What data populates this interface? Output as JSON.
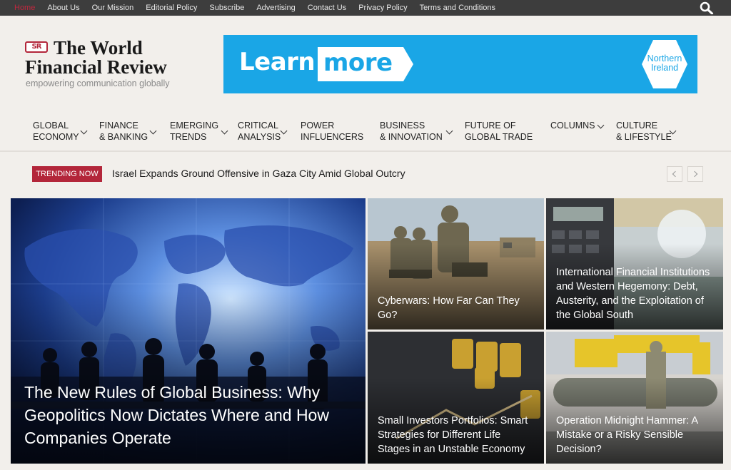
{
  "topnav": {
    "items": [
      "Home",
      "About Us",
      "Our Mission",
      "Editorial Policy",
      "Subscribe",
      "Advertising",
      "Contact Us",
      "Privacy Policy",
      "Terms and Conditions"
    ]
  },
  "logo": {
    "mark": "SR",
    "line1": "The World",
    "line2": "Financial Review",
    "tagline": "empowering communication globally"
  },
  "ad": {
    "learn": "Learn",
    "more": "more",
    "badge_line1": "Northern",
    "badge_line2": "Ireland",
    "colors": {
      "background": "#1aa6e6",
      "text": "#ffffff"
    }
  },
  "mainnav": {
    "items": [
      {
        "line1": "GLOBAL",
        "line2": "ECONOMY"
      },
      {
        "line1": "FINANCE",
        "line2": "& BANKING"
      },
      {
        "line1": "EMERGING",
        "line2": "TRENDS"
      },
      {
        "line1": "CRITICAL",
        "line2": "ANALYSIS"
      },
      {
        "line1": "POWER",
        "line2": "INFLUENCERS"
      },
      {
        "line1": "BUSINESS",
        "line2": "& INNOVATION"
      },
      {
        "line1": "FUTURE OF",
        "line2": "GLOBAL TRADE"
      },
      {
        "line1": "COLUMNS",
        "line2": ""
      },
      {
        "line1": "CULTURE",
        "line2": "& LIFESTYLE"
      }
    ]
  },
  "trending": {
    "label": "TRENDING NOW",
    "headline": "Israel Expands Ground Offensive in Gaza City Amid Global Outcry"
  },
  "articles": [
    {
      "title": "The New Rules of Global Business: Why Geopolitics Now Dictates Where and How Companies Operate"
    },
    {
      "title": "Cyberwars: How Far Can They Go?"
    },
    {
      "title": "International Financial Institutions and Western Hegemony: Debt, Austerity, and the Exploitation of the Global South"
    },
    {
      "title": "Small Investors Portfolios: Smart Strategies for Different Life Stages in an Unstable Economy"
    },
    {
      "title": "Operation Midnight Hammer: A Mistake or a Risky Sensible Decision?"
    }
  ],
  "colors": {
    "accent": "#b3263a",
    "topbar": "#3d3d3d",
    "page_bg": "#f2efeb"
  },
  "icons": {
    "search": "search-icon",
    "prev": "chevron-left-icon",
    "next": "chevron-right-icon"
  }
}
